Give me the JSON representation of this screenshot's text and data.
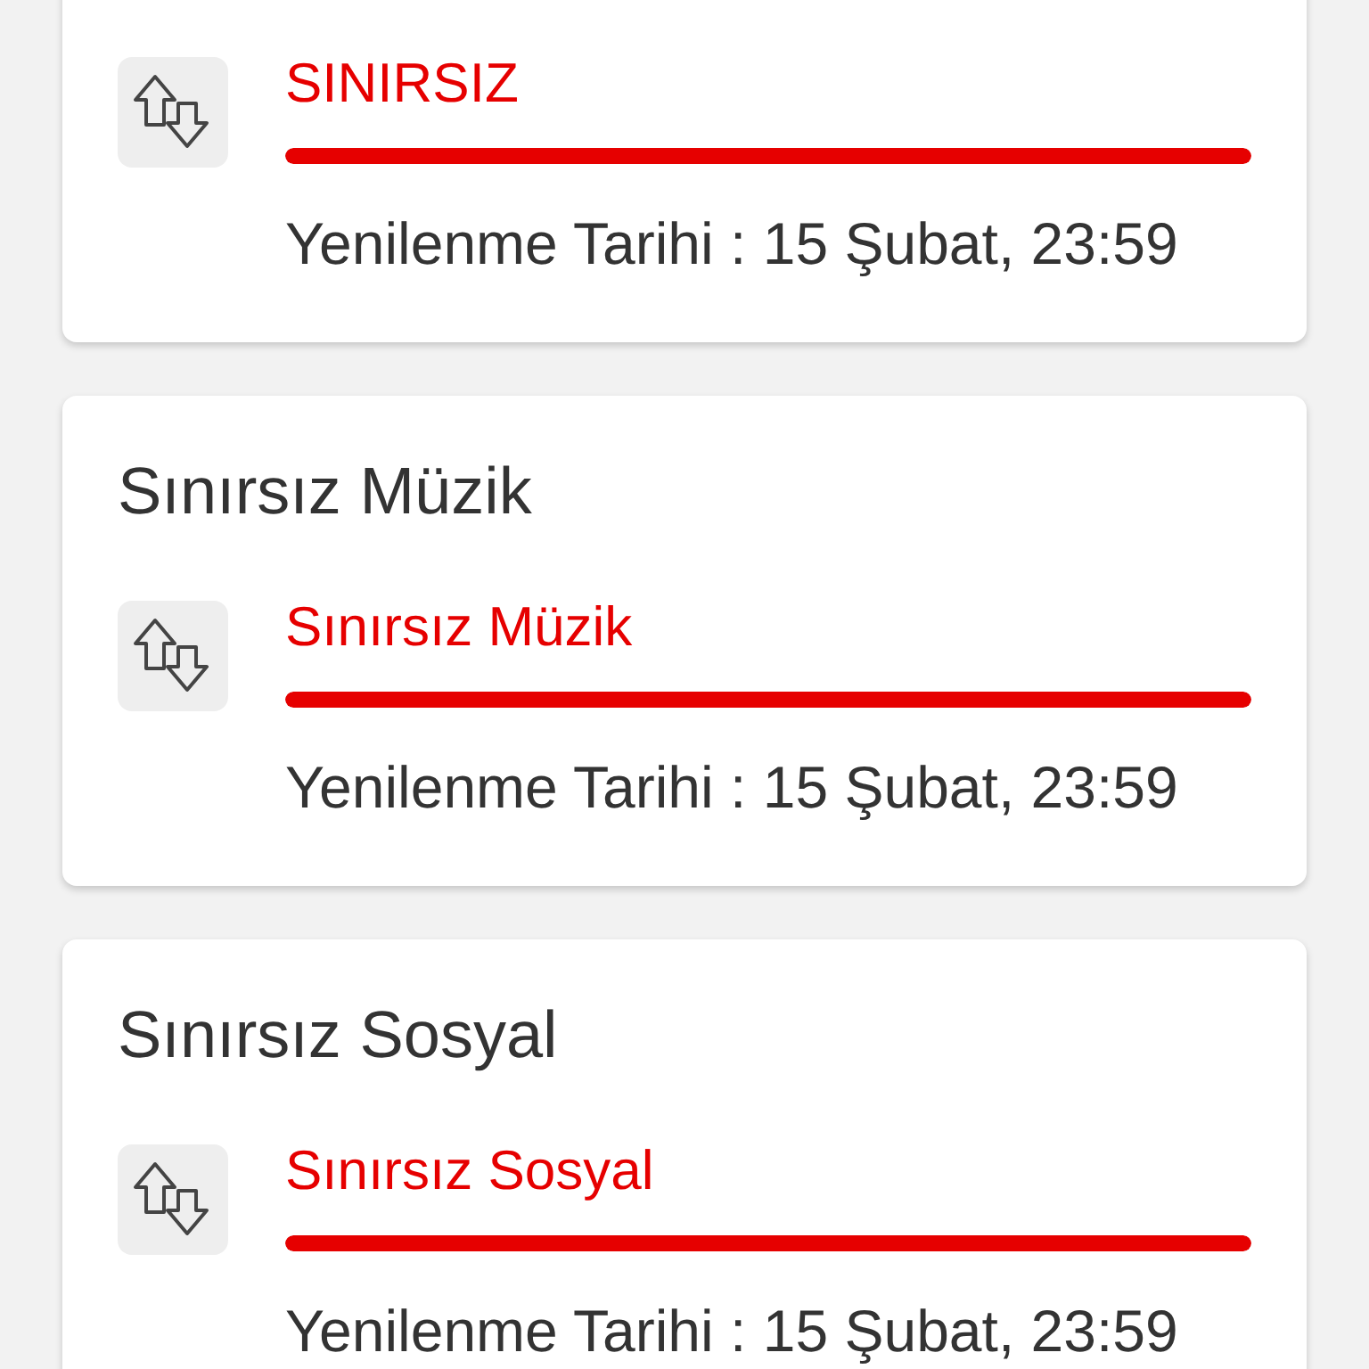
{
  "cards": [
    {
      "label": "SINIRSIZ",
      "level": 1,
      "renewal": "Yenilenme Tarihi : 15 Şubat, 23:59"
    },
    {
      "title": "Sınırsız Müzik",
      "label": "Sınırsız Müzik",
      "level": 1,
      "renewal": "Yenilenme Tarihi : 15 Şubat, 23:59"
    },
    {
      "title": "Sınırsız Sosyal",
      "label": "Sınırsız Sosyal",
      "level": 1,
      "renewal": "Yenilenme Tarihi : 15 Şubat, 23:59"
    }
  ]
}
